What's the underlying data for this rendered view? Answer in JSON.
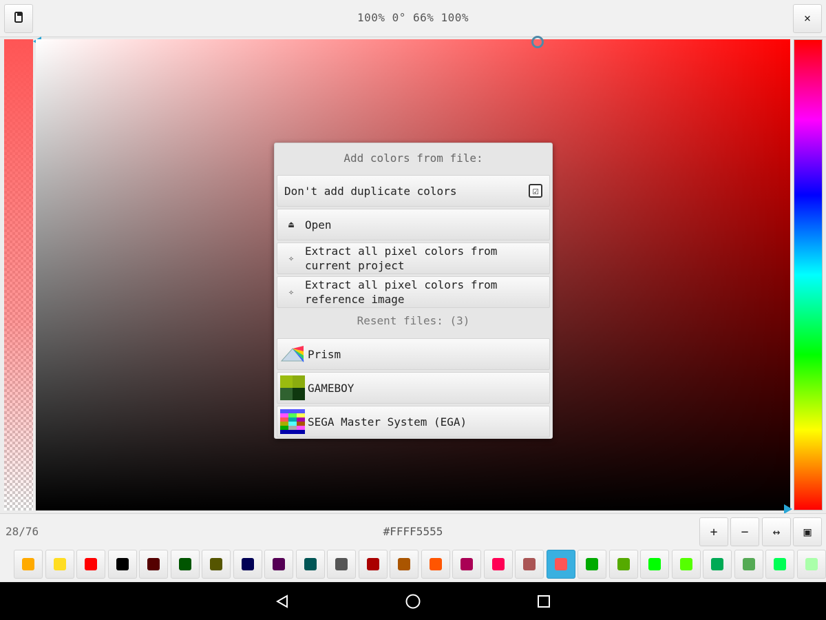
{
  "topbar": {
    "status": "100% 0° 66% 100%",
    "menu_icon": "device-menu-icon",
    "close_label": "×",
    "close_icon": "close-icon"
  },
  "picker": {
    "selected_color": "#FF5555",
    "hue_deg": 0,
    "saturation_pct": 66,
    "value_pct": 100,
    "alpha_pct": 100
  },
  "dialog": {
    "title": "Add colors from file:",
    "duplicate_label": "Don't add duplicate colors",
    "duplicate_checked": true,
    "check_mark": "☑",
    "open_icon": "⏏",
    "open_label": "Open",
    "extract_icon": "✧",
    "extract_project_line1": "Extract all pixel colors from",
    "extract_project_line2": "current project",
    "extract_reference_line1": "Extract all pixel colors from",
    "extract_reference_line2": "reference image",
    "recent_title": "Resent files: (3)",
    "recent_files": [
      {
        "label": "Prism",
        "icon": "prism-palette-icon"
      },
      {
        "label": "GAMEBOY",
        "icon": "gameboy-palette-icon"
      },
      {
        "label": "SEGA Master System (EGA)",
        "icon": "sega-palette-icon"
      }
    ]
  },
  "bottombar": {
    "count": "28/76",
    "hex": "#FFFF5555",
    "add_label": "+",
    "remove_label": "−",
    "move_label": "↔",
    "fit_label": "▣"
  },
  "palette": {
    "selected_index": 17,
    "colors": [
      "#ffaa00",
      "#ffdd22",
      "#ff0000",
      "#000000",
      "#550000",
      "#005500",
      "#555500",
      "#000055",
      "#550055",
      "#005555",
      "#555555",
      "#aa0000",
      "#aa5500",
      "#ff5500",
      "#aa0055",
      "#ff0055",
      "#aa5555",
      "#ff5555",
      "#00aa00",
      "#55aa00",
      "#00ff00",
      "#55ff00",
      "#00aa55",
      "#55aa55",
      "#00ff55",
      "#aaffaa"
    ]
  },
  "navbar": {
    "back_icon": "back-triangle-icon",
    "home_icon": "home-circle-icon",
    "recents_icon": "recents-square-icon"
  }
}
